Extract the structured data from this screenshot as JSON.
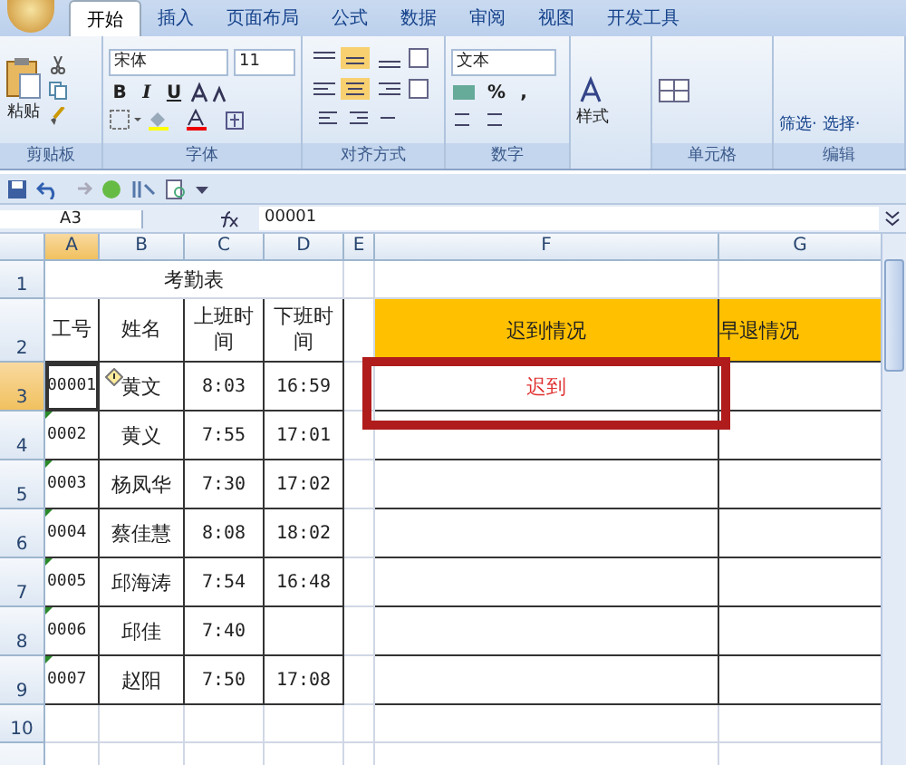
{
  "ribbon": {
    "tabs": [
      {
        "label": "开始",
        "selected": true
      },
      {
        "label": "插入",
        "selected": false
      },
      {
        "label": "页面布局",
        "selected": false
      },
      {
        "label": "公式",
        "selected": false
      },
      {
        "label": "数据",
        "selected": false
      },
      {
        "label": "审阅",
        "selected": false
      },
      {
        "label": "视图",
        "selected": false
      },
      {
        "label": "开发工具",
        "selected": false
      }
    ],
    "groups": [
      {
        "kind": "clipboard",
        "label": "剪贴板",
        "button": "粘贴"
      },
      {
        "kind": "font",
        "label": "字体",
        "font": "宋体",
        "size": "11",
        "buttons": [
          "B",
          "I",
          "U"
        ]
      },
      {
        "kind": "align",
        "label": "对齐方式"
      },
      {
        "kind": "number",
        "label": "数字",
        "format": "文本",
        "buttons": [
          "%",
          ","
        ]
      },
      {
        "kind": "styles",
        "button": "样式"
      },
      {
        "kind": "cells",
        "label": "单元格"
      },
      {
        "kind": "editing",
        "label": "编辑",
        "buttons": [
          "筛选·",
          "选择·"
        ]
      }
    ]
  },
  "formula_bar": {
    "name_box": "A3",
    "value": "00001"
  },
  "columns": [
    {
      "label": "A",
      "selected": true
    },
    {
      "label": "B",
      "selected": false
    },
    {
      "label": "C",
      "selected": false
    },
    {
      "label": "D",
      "selected": false
    },
    {
      "label": "E",
      "selected": false
    },
    {
      "label": "F",
      "selected": false
    },
    {
      "label": "G",
      "selected": false
    }
  ],
  "rows": [
    {
      "header": "1",
      "kind": "title",
      "selected": false,
      "title": "考勤表"
    },
    {
      "header": "2",
      "kind": "header",
      "selected": false,
      "cells": [
        "工号",
        "姓名",
        "上班时间",
        "下班时间",
        "迟到情况",
        "早退情况"
      ]
    },
    {
      "header": "3",
      "kind": "data",
      "selected": true,
      "id": "00001",
      "name": "黄文",
      "in": "8:03",
      "out": "16:59",
      "late": "迟到",
      "warning": false,
      "smart_tag": true
    },
    {
      "header": "4",
      "kind": "data",
      "selected": false,
      "id": "0002",
      "name": "黄义",
      "in": "7:55",
      "out": "17:01",
      "warning": true,
      "smart_tag": false
    },
    {
      "header": "5",
      "kind": "data",
      "selected": false,
      "id": "0003",
      "name": "杨凤华",
      "in": "7:30",
      "out": "17:02",
      "warning": true,
      "smart_tag": false
    },
    {
      "header": "6",
      "kind": "data",
      "selected": false,
      "id": "0004",
      "name": "蔡佳慧",
      "in": "8:08",
      "out": "18:02",
      "warning": true,
      "smart_tag": false
    },
    {
      "header": "7",
      "kind": "data",
      "selected": false,
      "id": "0005",
      "name": "邱海涛",
      "in": "7:54",
      "out": "16:48",
      "warning": true,
      "smart_tag": false
    },
    {
      "header": "8",
      "kind": "data",
      "selected": false,
      "id": "0006",
      "name": "邱佳",
      "in": "7:40",
      "warning": true,
      "smart_tag": false
    },
    {
      "header": "9",
      "kind": "data",
      "selected": false,
      "id": "0007",
      "name": "赵阳",
      "in": "7:50",
      "out": "17:08",
      "warning": true,
      "smart_tag": false
    },
    {
      "header": "10",
      "kind": "empty",
      "selected": false
    }
  ]
}
